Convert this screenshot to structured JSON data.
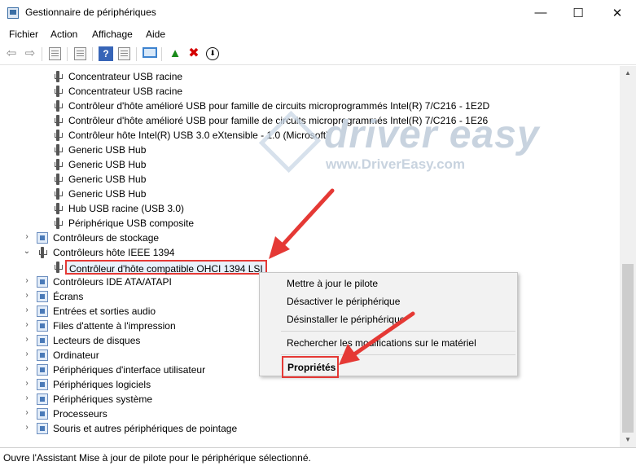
{
  "window": {
    "title": "Gestionnaire de périphériques",
    "min_glyph": "—",
    "max_glyph": "☐",
    "close_glyph": "✕"
  },
  "menubar": {
    "items": [
      "Fichier",
      "Action",
      "Affichage",
      "Aide"
    ]
  },
  "toolbar": {
    "icons": [
      "back-arrow-icon",
      "forward-arrow-icon",
      "properties-sheet-icon",
      "refresh-icon",
      "help-icon",
      "properties-panel-icon",
      "monitor-icon",
      "update-driver-icon",
      "uninstall-icon",
      "download-icon"
    ],
    "back_glyph": "⇦",
    "forward_glyph": "⇨",
    "help_glyph": "?",
    "update_glyph": "▲",
    "uninstall_glyph": "✖",
    "download_glyph": "⬇"
  },
  "tree": {
    "usb_children": [
      "Concentrateur USB racine",
      "Concentrateur USB racine",
      "Contrôleur d'hôte amélioré USB pour famille de circuits microprogrammés Intel(R) 7/C216 - 1E2D",
      "Contrôleur d'hôte amélioré USB pour famille de circuits microprogrammés Intel(R) 7/C216 - 1E26",
      "Contrôleur hôte Intel(R) USB 3.0 eXtensible - 1.0 (Microsoft)",
      "Generic USB Hub",
      "Generic USB Hub",
      "Generic USB Hub",
      "Generic USB Hub",
      "Hub USB racine (USB 3.0)",
      "Périphérique USB composite"
    ],
    "storage": "Contrôleurs de stockage",
    "ieee": "Contrôleurs hôte IEEE 1394",
    "ieee_child": "Contrôleur d'hôte compatible OHCI 1394 LSI",
    "categories": [
      "Contrôleurs IDE ATA/ATAPI",
      "Écrans",
      "Entrées et sorties audio",
      "Files d'attente à l'impression",
      "Lecteurs de disques",
      "Ordinateur",
      "Périphériques d'interface utilisateur",
      "Périphériques logiciels",
      "Périphériques système",
      "Processeurs",
      "Souris et autres périphériques de pointage"
    ],
    "collapsed_glyph": "›",
    "expanded_glyph": "⌄"
  },
  "watermark": {
    "brand": "driver easy",
    "url": "www.DriverEasy.com"
  },
  "context_menu": {
    "update": "Mettre à jour le pilote",
    "disable": "Désactiver le périphérique",
    "uninstall": "Désinstaller le périphérique",
    "scan": "Rechercher les modifications sur le matériel",
    "properties": "Propriétés"
  },
  "status": {
    "text": "Ouvre l'Assistant Mise à jour de pilote pour le périphérique sélectionné."
  },
  "colors": {
    "highlight_red": "#e53935",
    "selection_bg": "#e8f1fb"
  }
}
